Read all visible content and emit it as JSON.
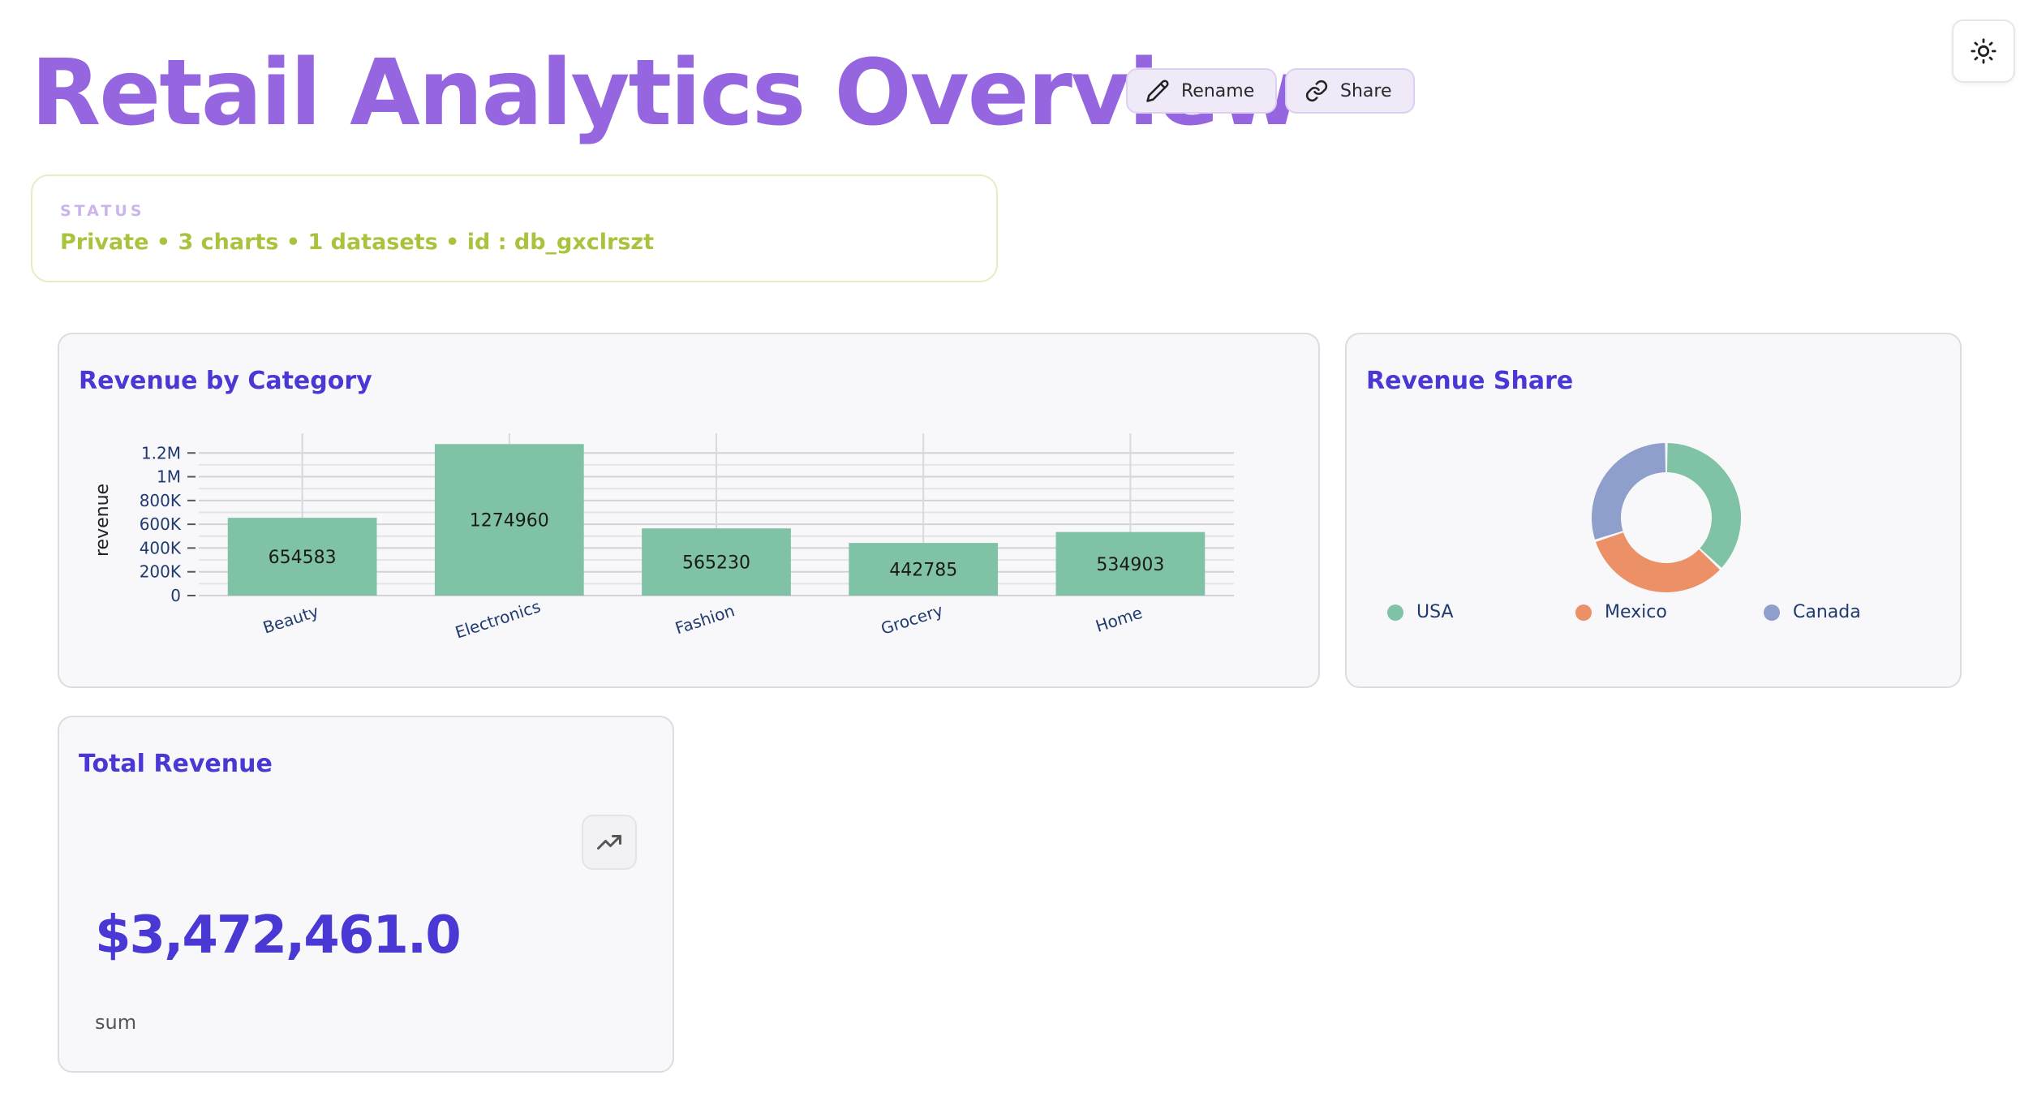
{
  "header": {
    "title": "Retail Analytics Overview",
    "rename_label": "Rename",
    "share_label": "Share",
    "theme_icon": "sun-icon"
  },
  "status": {
    "label": "STATUS",
    "text": "Private • 3 charts • 1 datasets • id : db_gxclrszt"
  },
  "colors": {
    "title": "#9665e0",
    "card_title": "#4a38d4",
    "status_text": "#a8c43e",
    "bar": "#7fc2a5",
    "usa": "#7fc2a5",
    "mexico": "#ec9068",
    "canada": "#8f9fcc"
  },
  "cards": {
    "revenue_by_category": {
      "title": "Revenue by Category"
    },
    "revenue_share": {
      "title": "Revenue Share"
    },
    "total_revenue": {
      "title": "Total Revenue",
      "value": "$3,472,461.0",
      "sub": "sum",
      "icon": "trending-up-icon"
    }
  },
  "chart_data": [
    {
      "type": "bar",
      "title": "Revenue by Category",
      "xlabel": "",
      "ylabel": "revenue",
      "categories": [
        "Beauty",
        "Electronics",
        "Fashion",
        "Grocery",
        "Home"
      ],
      "values": [
        654583,
        1274960,
        565230,
        442785,
        534903
      ],
      "data_labels": [
        "654583",
        "1274960",
        "565230",
        "442785",
        "534903"
      ],
      "ylim": [
        0,
        1270000
      ],
      "y_ticks": [
        0,
        200000,
        400000,
        600000,
        800000,
        1000000,
        1200000
      ],
      "y_tick_labels": [
        "0",
        "200K",
        "400K",
        "600K",
        "800K",
        "1M",
        "1.2M"
      ],
      "grid": true
    },
    {
      "type": "pie",
      "title": "Revenue Share",
      "donut": true,
      "labels": [
        "USA",
        "Mexico",
        "Canada"
      ],
      "values": [
        37,
        33,
        30
      ],
      "legend": "bottom"
    }
  ]
}
